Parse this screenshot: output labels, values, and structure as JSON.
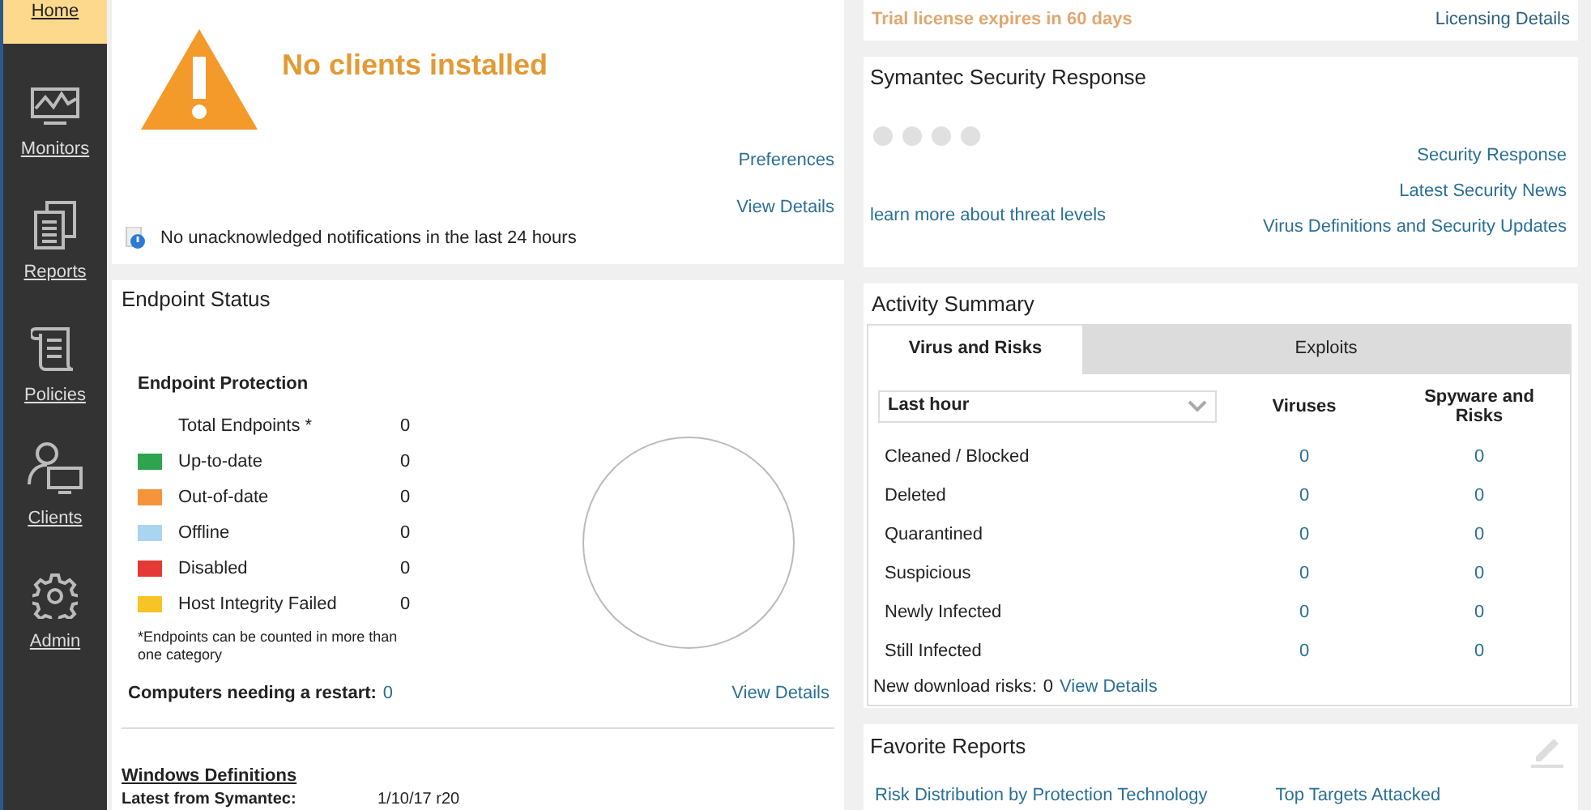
{
  "nav": [
    {
      "label": "Home",
      "selected": true
    },
    {
      "label": "Monitors",
      "selected": false
    },
    {
      "label": "Reports",
      "selected": false
    },
    {
      "label": "Policies",
      "selected": false
    },
    {
      "label": "Clients",
      "selected": false
    },
    {
      "label": "Admin",
      "selected": false
    }
  ],
  "status_panel": {
    "message": "No clients installed",
    "links": [
      "Preferences",
      "View Details"
    ],
    "notification": "No unacknowledged notifications in the last 24 hours"
  },
  "license": {
    "text": "Trial license expires in 60 days",
    "link": "Licensing Details"
  },
  "security_response": {
    "title": "Symantec Security Response",
    "learn_more": "learn more about threat levels",
    "links": [
      "Security Response",
      "Latest Security News",
      "Virus Definitions and Security Updates"
    ]
  },
  "endpoint_status": {
    "title": "Endpoint Status",
    "section": "Endpoint Protection",
    "rows": [
      {
        "label": "Total Endpoints *",
        "value": "0"
      },
      {
        "label": "Up-to-date",
        "value": "0",
        "color": "#2ea44f"
      },
      {
        "label": "Out-of-date",
        "value": "0",
        "color": "#f5943a"
      },
      {
        "label": "Offline",
        "value": "0",
        "color": "#a9d5f2"
      },
      {
        "label": "Disabled",
        "value": "0",
        "color": "#e53935"
      },
      {
        "label": "Host Integrity Failed",
        "value": "0",
        "color": "#f7c325"
      }
    ],
    "footnote": "*Endpoints can be counted in more than one category",
    "restart_label": "Computers needing a restart:",
    "restart_value": "0",
    "view_details": "View Details",
    "definitions_title": "Windows Definitions",
    "definitions": [
      {
        "label": "Latest from Symantec:",
        "value": "1/10/17 r20"
      }
    ]
  },
  "activity": {
    "title": "Activity Summary",
    "tabs": [
      {
        "label": "Virus and Risks",
        "selected": true
      },
      {
        "label": "Exploits",
        "selected": false
      }
    ],
    "period": "Last hour",
    "columns": [
      "Viruses",
      "Spyware and Risks"
    ],
    "rows": [
      {
        "label": "Cleaned / Blocked",
        "values": [
          "0",
          "0"
        ]
      },
      {
        "label": "Deleted",
        "values": [
          "0",
          "0"
        ]
      },
      {
        "label": "Quarantined",
        "values": [
          "0",
          "0"
        ]
      },
      {
        "label": "Suspicious",
        "values": [
          "0",
          "0"
        ]
      },
      {
        "label": "Newly Infected",
        "values": [
          "0",
          "0"
        ]
      },
      {
        "label": "Still Infected",
        "values": [
          "0",
          "0"
        ]
      }
    ],
    "download_label": "New download risks:",
    "download_value": "0",
    "download_link": "View Details"
  },
  "favorite_reports": {
    "title": "Favorite Reports",
    "links": [
      "Risk Distribution by Protection Technology",
      "Top Targets Attacked"
    ]
  }
}
